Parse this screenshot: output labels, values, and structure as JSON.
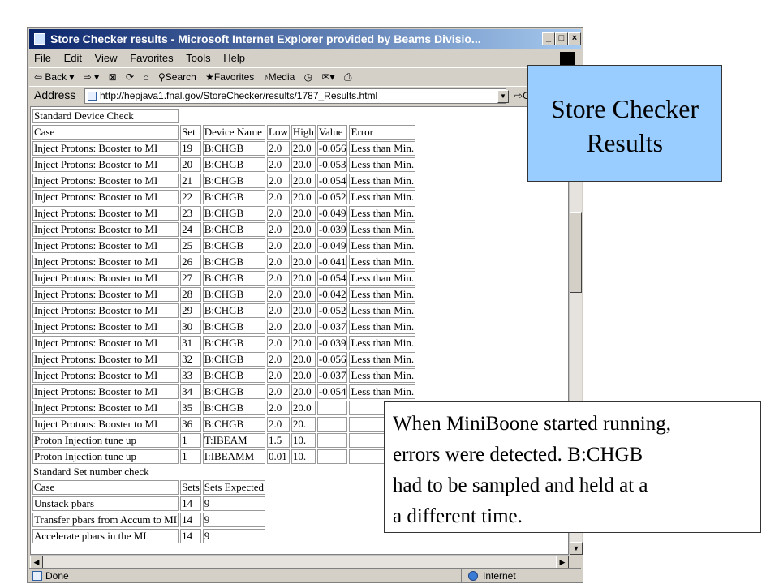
{
  "window": {
    "title": "Store Checker results - Microsoft Internet Explorer provided by Beams Divisio...",
    "minimize_glyph": "_",
    "maximize_glyph": "□",
    "close_glyph": "×"
  },
  "menu": [
    "File",
    "Edit",
    "View",
    "Favorites",
    "Tools",
    "Help"
  ],
  "toolbar": {
    "back_label": "Back",
    "search_label": "Search",
    "favorites_label": "Favorites",
    "media_label": "Media"
  },
  "address": {
    "label": "Address",
    "url": "http://hepjava1.fnal.gov/StoreChecker/results/1787_Results.html",
    "go_label": "Go"
  },
  "device_check": {
    "title": "Standard Device Check",
    "headers": [
      "Case",
      "Set",
      "Device Name",
      "Low",
      "High",
      "Value",
      "Error"
    ],
    "rows": [
      [
        "Inject Protons: Booster to MI",
        "19",
        "B:CHGB",
        "2.0",
        "20.0",
        "-0.056",
        "Less than Min."
      ],
      [
        "Inject Protons: Booster to MI",
        "20",
        "B:CHGB",
        "2.0",
        "20.0",
        "-0.053",
        "Less than Min."
      ],
      [
        "Inject Protons: Booster to MI",
        "21",
        "B:CHGB",
        "2.0",
        "20.0",
        "-0.054",
        "Less than Min."
      ],
      [
        "Inject Protons: Booster to MI",
        "22",
        "B:CHGB",
        "2.0",
        "20.0",
        "-0.052",
        "Less than Min."
      ],
      [
        "Inject Protons: Booster to MI",
        "23",
        "B:CHGB",
        "2.0",
        "20.0",
        "-0.049",
        "Less than Min."
      ],
      [
        "Inject Protons: Booster to MI",
        "24",
        "B:CHGB",
        "2.0",
        "20.0",
        "-0.039",
        "Less than Min."
      ],
      [
        "Inject Protons: Booster to MI",
        "25",
        "B:CHGB",
        "2.0",
        "20.0",
        "-0.049",
        "Less than Min."
      ],
      [
        "Inject Protons: Booster to MI",
        "26",
        "B:CHGB",
        "2.0",
        "20.0",
        "-0.041",
        "Less than Min."
      ],
      [
        "Inject Protons: Booster to MI",
        "27",
        "B:CHGB",
        "2.0",
        "20.0",
        "-0.054",
        "Less than Min."
      ],
      [
        "Inject Protons: Booster to MI",
        "28",
        "B:CHGB",
        "2.0",
        "20.0",
        "-0.042",
        "Less than Min."
      ],
      [
        "Inject Protons: Booster to MI",
        "29",
        "B:CHGB",
        "2.0",
        "20.0",
        "-0.052",
        "Less than Min."
      ],
      [
        "Inject Protons: Booster to MI",
        "30",
        "B:CHGB",
        "2.0",
        "20.0",
        "-0.037",
        "Less than Min."
      ],
      [
        "Inject Protons: Booster to MI",
        "31",
        "B:CHGB",
        "2.0",
        "20.0",
        "-0.039",
        "Less than Min."
      ],
      [
        "Inject Protons: Booster to MI",
        "32",
        "B:CHGB",
        "2.0",
        "20.0",
        "-0.056",
        "Less than Min."
      ],
      [
        "Inject Protons: Booster to MI",
        "33",
        "B:CHGB",
        "2.0",
        "20.0",
        "-0.037",
        "Less than Min."
      ],
      [
        "Inject Protons: Booster to MI",
        "34",
        "B:CHGB",
        "2.0",
        "20.0",
        "-0.054",
        "Less than Min."
      ],
      [
        "Inject Protons: Booster to MI",
        "35",
        "B:CHGB",
        "2.0",
        "20.0",
        "",
        ""
      ],
      [
        "Inject Protons: Booster to MI",
        "36",
        "B:CHGB",
        "2.0",
        "20.",
        "",
        ""
      ],
      [
        "Proton Injection tune up",
        "1",
        "T:IBEAM",
        "1.5",
        "10.",
        "",
        ""
      ],
      [
        "Proton Injection tune up",
        "1",
        "I:IBEAMM",
        "0.01",
        "10.",
        "",
        ""
      ]
    ]
  },
  "set_number_check": {
    "title": "Standard Set number check",
    "headers": [
      "Case",
      "Sets",
      "Sets Expected"
    ],
    "rows": [
      [
        "Unstack pbars",
        "14",
        "9"
      ],
      [
        "Transfer pbars from Accum to MI",
        "14",
        "9"
      ],
      [
        "Accelerate pbars in the MI",
        "14",
        "9"
      ]
    ]
  },
  "status": {
    "left": "Done",
    "zone": "Internet"
  },
  "callouts": {
    "title_line1": "Store Checker",
    "title_line2": "Results",
    "note_lines": [
      "When MiniBoone started running,",
      "errors were detected. B:CHGB",
      "had to be sampled and held at a",
      "a different time."
    ]
  },
  "colors": {
    "titlebar_start": "#0a246a",
    "titlebar_end": "#a6caf0",
    "callout_bg": "#99ccff",
    "chrome": "#d4d0c8"
  },
  "icons": [
    "ie-logo-icon",
    "back-arrow-icon",
    "forward-arrow-icon",
    "stop-icon",
    "refresh-icon",
    "home-icon",
    "search-icon",
    "favorites-icon",
    "media-icon",
    "history-icon",
    "mail-icon",
    "print-icon",
    "windows-flag-icon",
    "page-icon",
    "globe-icon"
  ]
}
